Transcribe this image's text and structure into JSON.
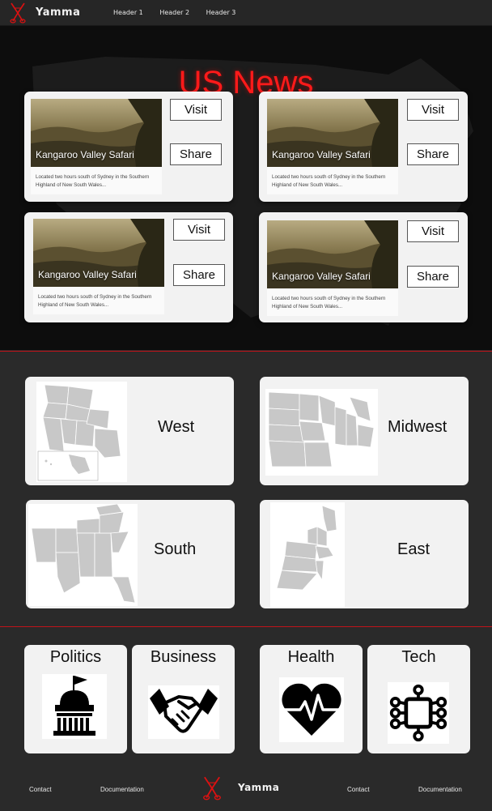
{
  "nav": {
    "brand": "Yamma",
    "links": [
      "Header 1",
      "Header 2",
      "Header 3"
    ],
    "logo_icon": "scissors-figure-icon"
  },
  "hero": {
    "title": "US News",
    "title_color": "#ff1a1a"
  },
  "news_cards": [
    {
      "caption": "Kangaroo Valley Safari",
      "description": "Located two hours south of Sydney in the Southern Highland of New South Wales...",
      "visit_label": "Visit",
      "share_label": "Share"
    },
    {
      "caption": "Kangaroo Valley Safari",
      "description": "Located two hours south of Sydney in the Southern Highland of New South Wales...",
      "visit_label": "Visit",
      "share_label": "Share"
    },
    {
      "caption": "Kangaroo Valley Safari",
      "description": "Located two hours south of Sydney in the Southern Highland of New South Wales...",
      "visit_label": "Visit",
      "share_label": "Share"
    },
    {
      "caption": "Kangaroo Valley Safari",
      "description": "Located two hours south of Sydney in the Southern Highland of New South Wales...",
      "visit_label": "Visit",
      "share_label": "Share"
    }
  ],
  "regions": [
    {
      "label": "West",
      "icon": "west-region-map-icon"
    },
    {
      "label": "Midwest",
      "icon": "midwest-region-map-icon"
    },
    {
      "label": "South",
      "icon": "south-region-map-icon"
    },
    {
      "label": "East",
      "icon": "east-region-map-icon"
    }
  ],
  "categories": [
    {
      "label": "Politics",
      "icon": "capitol-building-icon"
    },
    {
      "label": "Business",
      "icon": "handshake-icon"
    },
    {
      "label": "Health",
      "icon": "heart-pulse-icon"
    },
    {
      "label": "Tech",
      "icon": "circuit-icon"
    }
  ],
  "footer": {
    "brand": "Yamma",
    "links": [
      "Contact",
      "Documentation",
      "Contact",
      "Documentation"
    ]
  },
  "colors": {
    "accent": "#c0141a",
    "card_bg": "#f2f2f2",
    "page_bg": "#2a2a2a"
  }
}
